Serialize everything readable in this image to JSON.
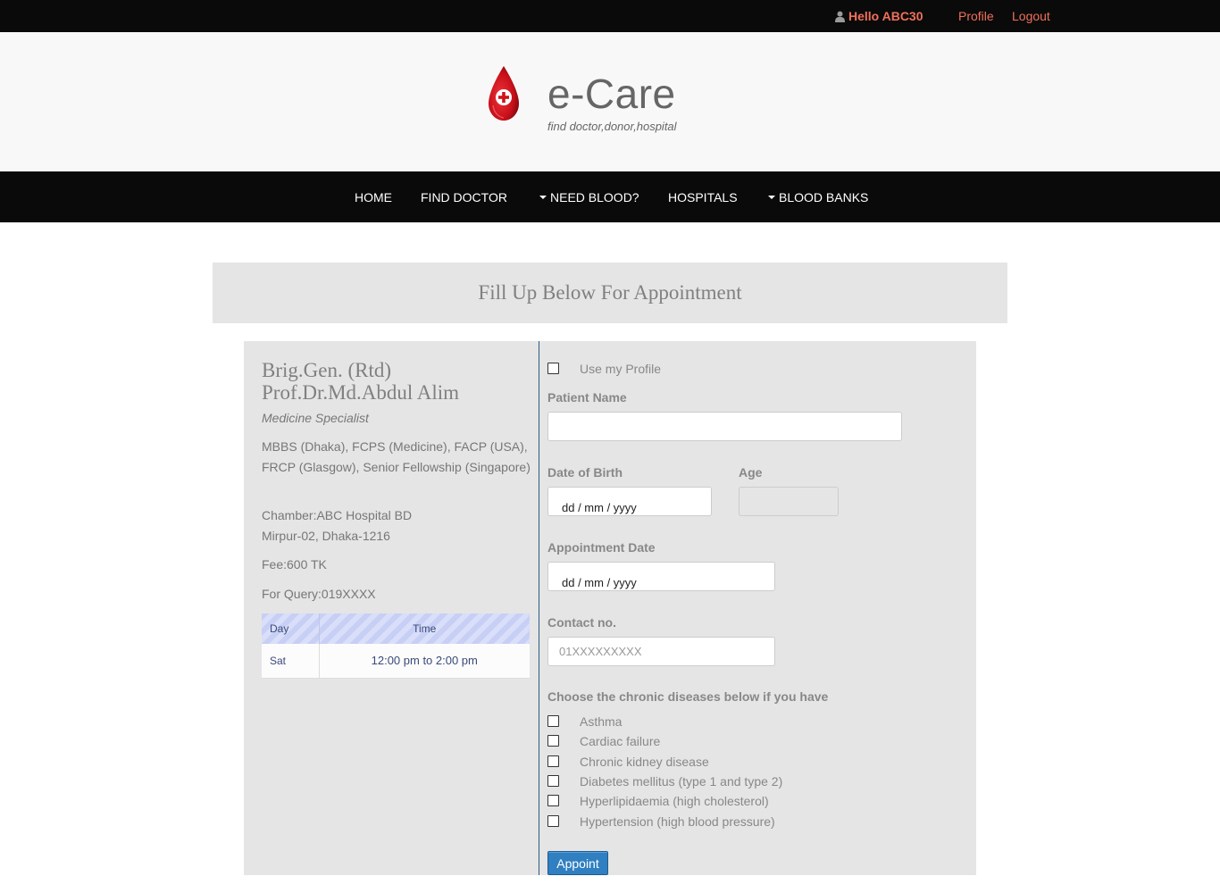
{
  "topbar": {
    "greeting": "Hello ABC30",
    "profile_link": "Profile",
    "logout_link": "Logout"
  },
  "header": {
    "brand": "e-Care",
    "tagline": "find doctor,donor,hospital"
  },
  "nav": {
    "items": [
      {
        "label": "HOME"
      },
      {
        "label": "FIND DOCTOR"
      },
      {
        "label": "NEED BLOOD?"
      },
      {
        "label": "HOSPITALS"
      },
      {
        "label": "BLOOD BANKS"
      }
    ]
  },
  "page_title": "Fill Up Below For Appointment",
  "doctor": {
    "name_line1": "Brig.Gen. (Rtd)",
    "name_line2": "Prof.Dr.Md.Abdul Alim",
    "specialty": "Medicine Specialist",
    "qualifications": "MBBS (Dhaka), FCPS (Medicine), FACP (USA), FRCP (Glasgow), Senior Fellowship (Singapore)",
    "chamber": "Chamber:ABC Hospital BD",
    "address": "Mirpur-02, Dhaka-1216",
    "fee": "Fee:600 TK",
    "query": "For Query:019XXXX",
    "schedule": {
      "headers": [
        "Day",
        "Time"
      ],
      "rows": [
        {
          "day": "Sat",
          "time": "12:00 pm to 2:00 pm"
        }
      ]
    }
  },
  "form": {
    "use_profile_label": "Use my Profile",
    "patient_name_label": "Patient Name",
    "patient_name_value": "",
    "dob_label": "Date of Birth",
    "dob_placeholder": "dd / mm / yyyy",
    "age_label": "Age",
    "appt_date_label": "Appointment Date",
    "appt_date_placeholder": "dd / mm / yyyy",
    "contact_label": "Contact no.",
    "contact_placeholder": "01XXXXXXXXX",
    "diseases_label": "Choose the chronic diseases below if you have",
    "diseases": [
      "Asthma",
      "Cardiac failure",
      "Chronic kidney disease",
      "Diabetes mellitus (type 1 and type 2)",
      "Hyperlipidaemia (high cholesterol)",
      "Hypertension (high blood pressure)"
    ],
    "submit_label": "Appoint"
  },
  "colors": {
    "topbar_link": "#f0705a",
    "nav_bg": "#0a0a0a",
    "button": "#2f7fc1",
    "logo_red": "#d0121b"
  }
}
